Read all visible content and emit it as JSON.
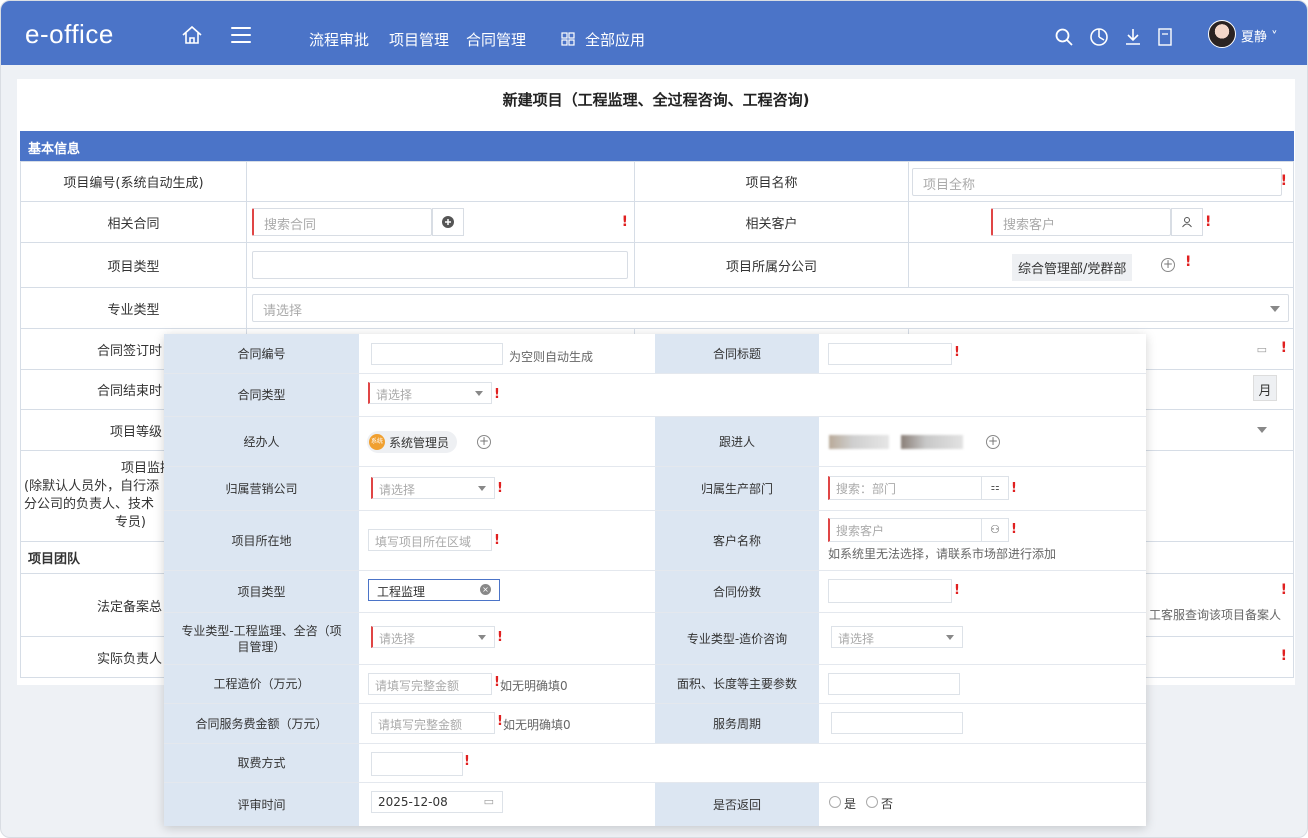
{
  "app": {
    "logo": "e-office",
    "user_name": "夏静"
  },
  "nav": {
    "items": [
      "流程审批",
      "项目管理",
      "合同管理"
    ],
    "all_apps": "全部应用"
  },
  "page": {
    "title": "新建项目（工程监理、全过程咨询、工程咨询)"
  },
  "basic_info": {
    "section_title": "基本信息",
    "project_no_label": "项目编号(系统自动生成)",
    "project_name_label": "项目名称",
    "project_name_placeholder": "项目全称",
    "contract_label": "相关合同",
    "contract_placeholder": "搜索合同",
    "customer_label": "相关客户",
    "customer_placeholder": "搜索客户",
    "project_type_label": "项目类型",
    "branch_label": "项目所属分公司",
    "branch_value": "综合管理部/党群部",
    "specialty_label": "专业类型",
    "specialty_placeholder": "请选择",
    "sign_time_label": "合同签订时",
    "end_time_label": "合同结束时",
    "end_unit": "月",
    "level_label": "项目等级",
    "monitor_label_1": "项目监控人",
    "monitor_label_2": "(除默认人员外，自行添",
    "monitor_label_3": "分公司的负责人、技术",
    "monitor_label_4": "专员)",
    "team_title": "项目团队",
    "legal_label": "法定备案总",
    "legal_hint": "工客服查询该项目备案人",
    "actual_label": "实际负责人",
    "required_mark": "!"
  },
  "modal": {
    "contract_no_label": "合同编号",
    "contract_no_hint": "为空则自动生成",
    "contract_title_label": "合同标题",
    "contract_type_label": "合同类型",
    "select_placeholder": "请选择",
    "handler_label": "经办人",
    "handler_badge": "系统",
    "handler_value": "系统管理员",
    "follower_label": "跟进人",
    "sales_company_label": "归属营销公司",
    "prod_dept_label": "归属生产部门",
    "prod_dept_placeholder": "搜索：部门",
    "location_label": "项目所在地",
    "location_placeholder": "填写项目所在区域",
    "customer_label": "客户名称",
    "customer_placeholder": "搜索客户",
    "customer_hint": "如系统里无法选择，请联系市场部进行添加",
    "project_type_label": "项目类型",
    "project_type_value": "工程监理",
    "copies_label": "合同份数",
    "specialty_label_1": "专业类型-工程监理、全咨（项",
    "specialty_label_2": "目管理）",
    "specialty_cost_label": "专业类型-造价咨询",
    "cost_label": "工程造价（万元）",
    "amount_placeholder": "请填写完整金额",
    "unknown_hint": "如无明确填0",
    "area_label": "面积、长度等主要参数",
    "fee_label": "合同服务费金额（万元）",
    "period_label": "服务周期",
    "charge_label": "取费方式",
    "review_label": "评审时间",
    "review_date": "2025-12-08",
    "return_label": "是否返回",
    "yes": "是",
    "no": "否"
  }
}
